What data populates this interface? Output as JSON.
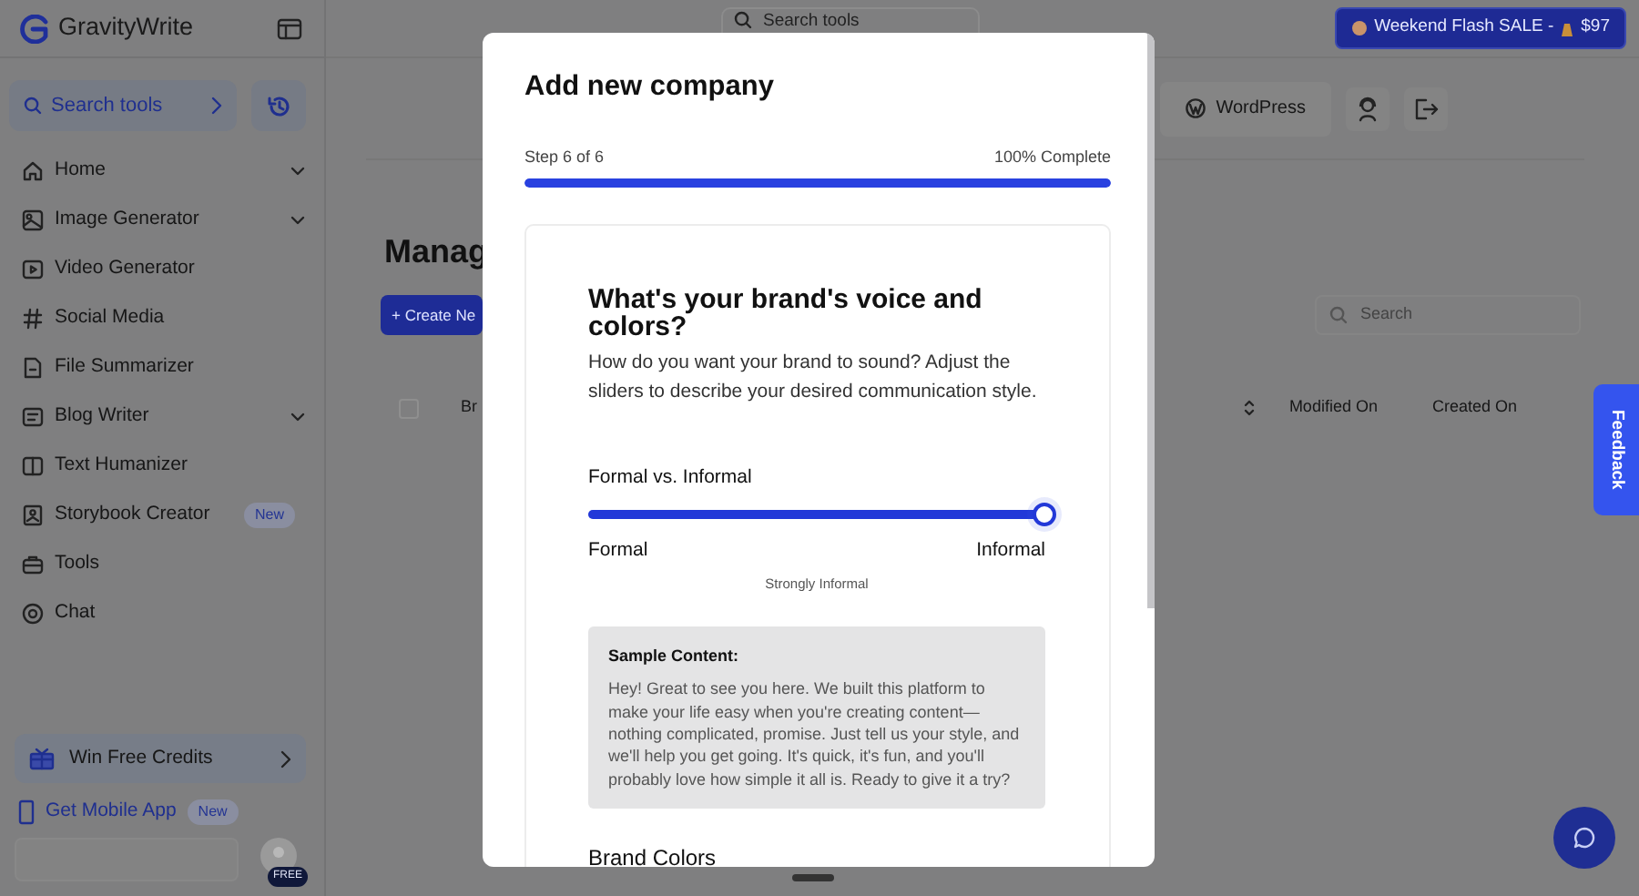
{
  "sidebar": {
    "brand": "GravityWrite",
    "search": {
      "label": "Search tools"
    },
    "items": [
      {
        "label": "Home",
        "expandable": true
      },
      {
        "label": "Image Generator",
        "expandable": true
      },
      {
        "label": "Video Generator",
        "expandable": false
      },
      {
        "label": "Social Media",
        "expandable": false
      },
      {
        "label": "File Summarizer",
        "expandable": false
      },
      {
        "label": "Blog Writer",
        "expandable": true
      },
      {
        "label": "Text Humanizer",
        "expandable": false
      },
      {
        "label": "Storybook Creator",
        "expandable": false,
        "badge": "New"
      },
      {
        "label": "Tools",
        "expandable": false
      },
      {
        "label": "Chat",
        "expandable": false
      }
    ],
    "promo": {
      "label": "Win Free Credits"
    },
    "mobile_app": {
      "label": "Get Mobile App",
      "badge": "New"
    },
    "plan_badge": "FREE"
  },
  "topbar": {
    "search": {
      "placeholder": "Search tools"
    },
    "sale": {
      "text": "Weekend Flash SALE -",
      "price": "$97"
    }
  },
  "toolbar": {
    "wordpress": "WordPress"
  },
  "page": {
    "title": "Manag",
    "create_button": "+ Create Ne",
    "search": {
      "placeholder": "Search"
    },
    "table": {
      "select_all": {
        "checked": false
      },
      "columns": [
        {
          "label": "Br"
        },
        {
          "label": "Modified On"
        },
        {
          "label": "Created On"
        }
      ]
    }
  },
  "modal": {
    "title": "Add new company",
    "step": "Step 6 of 6",
    "progress_text": "100% Complete",
    "progress": {
      "level": 1
    },
    "heading": "What's your brand's voice and colors?",
    "description": "How do you want your brand to sound? Adjust the sliders to describe your desired communication style.",
    "slider": {
      "label": "Formal vs. Informal",
      "level": 1,
      "min_label": "Formal",
      "max_label": "Informal",
      "reading": "Strongly Informal"
    },
    "sample": {
      "title": "Sample Content:",
      "text": "Hey! Great to see you here. We built this platform to make your life easy when you're creating content—nothing complicated, promise. Just tell us your style, and we'll help you get going. It's quick, it's fun, and you'll probably love how simple it all is. Ready to give it a try?"
    },
    "next_section": "Brand Colors"
  },
  "feedback": "Feedback"
}
